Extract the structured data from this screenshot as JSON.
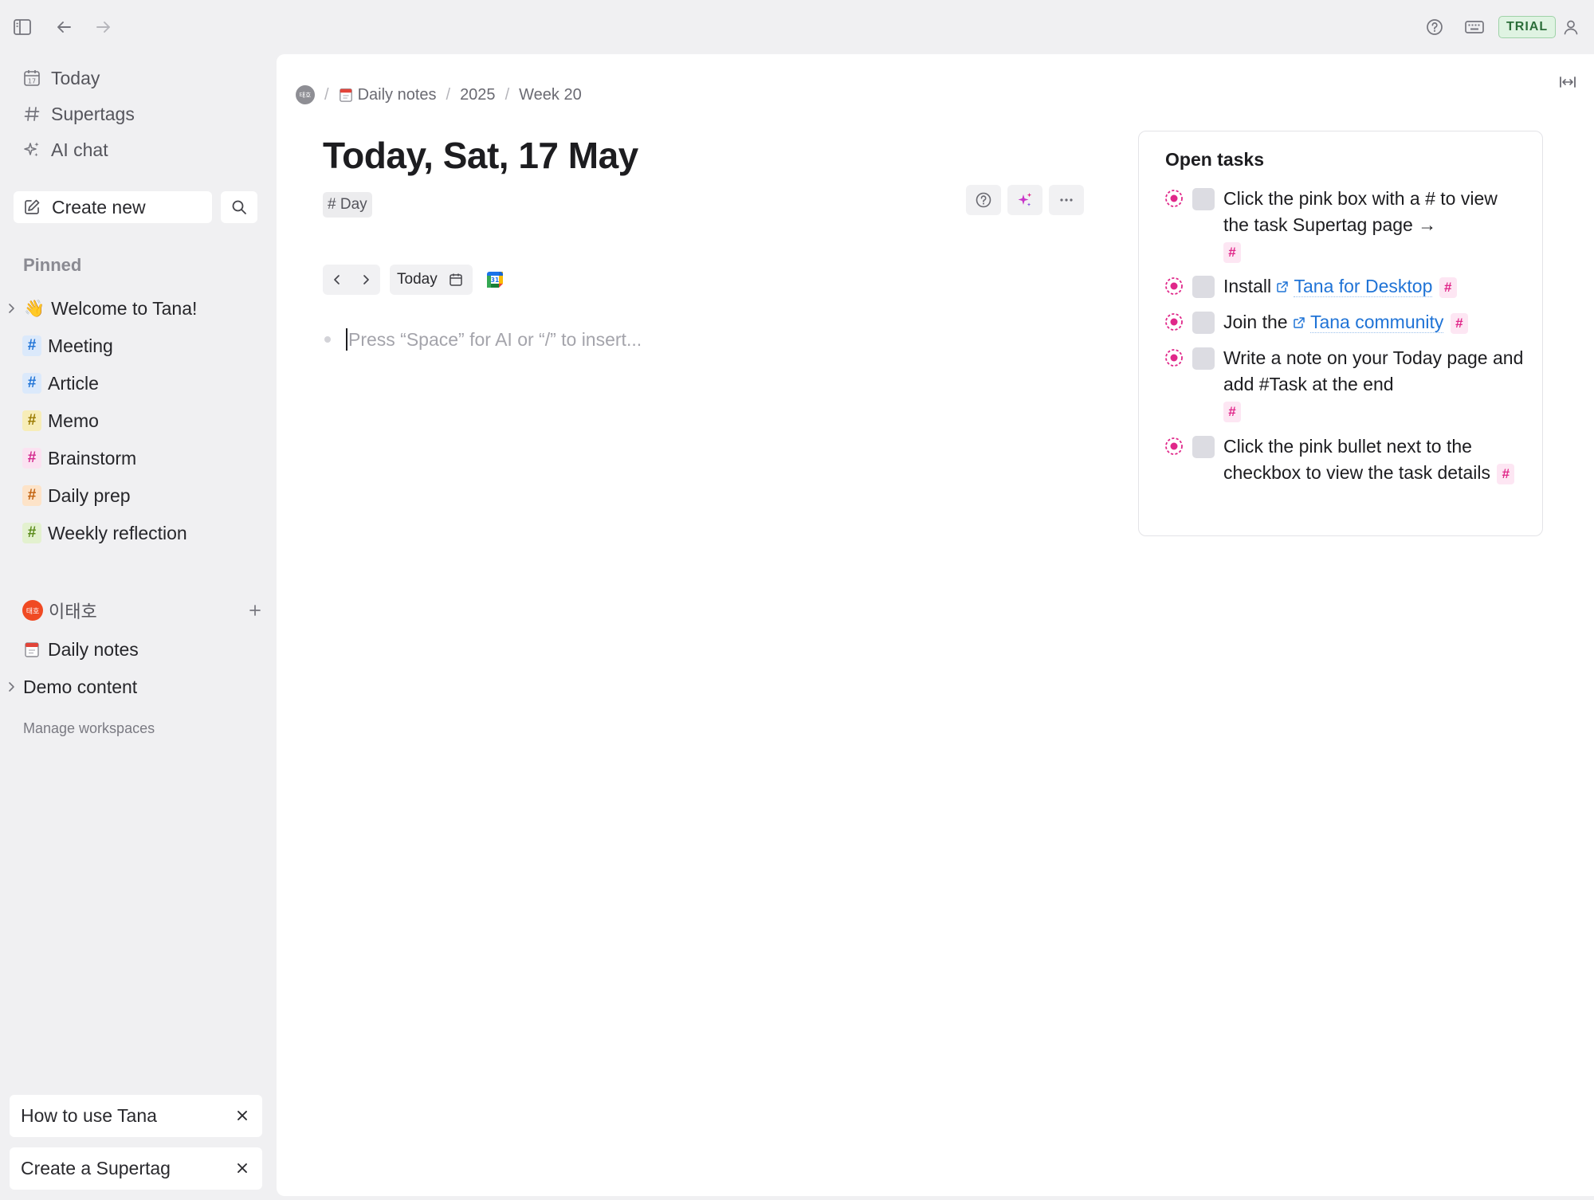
{
  "sidebar": {
    "nav": [
      {
        "label": "Today",
        "icon": "calendar-icon"
      },
      {
        "label": "Supertags",
        "icon": "hash-icon"
      },
      {
        "label": "AI chat",
        "icon": "sparkle-icon"
      }
    ],
    "create_new_label": "Create new",
    "pinned_label": "Pinned",
    "pinned": [
      {
        "label": "Welcome to Tana!",
        "emoji": "👋",
        "expandable": true
      },
      {
        "label": "Meeting",
        "tag_color": "#1f73d6",
        "tag_bg": "#dbe9fb"
      },
      {
        "label": "Article",
        "tag_color": "#1f73d6",
        "tag_bg": "#dbe9fb"
      },
      {
        "label": "Memo",
        "tag_color": "#9a7a00",
        "tag_bg": "#f7edb8"
      },
      {
        "label": "Brainstorm",
        "tag_color": "#d42a8f",
        "tag_bg": "#fbe2f1"
      },
      {
        "label": "Daily prep",
        "tag_color": "#c2620f",
        "tag_bg": "#fde3c8"
      },
      {
        "label": "Weekly reflection",
        "tag_color": "#5a8a1a",
        "tag_bg": "#e3f1cf"
      }
    ],
    "workspace": {
      "avatar_text": "태호",
      "name": "이태호"
    },
    "workspace_items": [
      {
        "label": "Daily notes",
        "icon": "daily-notes-icon"
      },
      {
        "label": "Demo content",
        "expandable": true
      }
    ],
    "manage_workspaces": "Manage workspaces",
    "help_cards": [
      "How to use Tana",
      "Create a Supertag"
    ]
  },
  "topbar": {
    "trial_label": "TRIAL"
  },
  "breadcrumb": {
    "avatar_text": "태호",
    "items": [
      "Daily notes",
      "2025",
      "Week 20"
    ]
  },
  "page": {
    "title": "Today, Sat, 17 May",
    "tag": "# Day",
    "date_nav_today": "Today",
    "editor_placeholder": "Press “Space” for AI or “/” to insert..."
  },
  "tasks": {
    "title": "Open tasks",
    "items": [
      {
        "text": "Click the pink box with a # to view the task Supertag page →"
      },
      {
        "before": "Install ",
        "link": "Tana for Desktop"
      },
      {
        "before": "Join the ",
        "link": "Tana community"
      },
      {
        "text": "Write a note on your Today page and add #Task at the end"
      },
      {
        "text": "Click the pink bullet next to the checkbox to view the task details"
      }
    ],
    "hash_symbol": "#",
    "accent": "#e0288a"
  }
}
